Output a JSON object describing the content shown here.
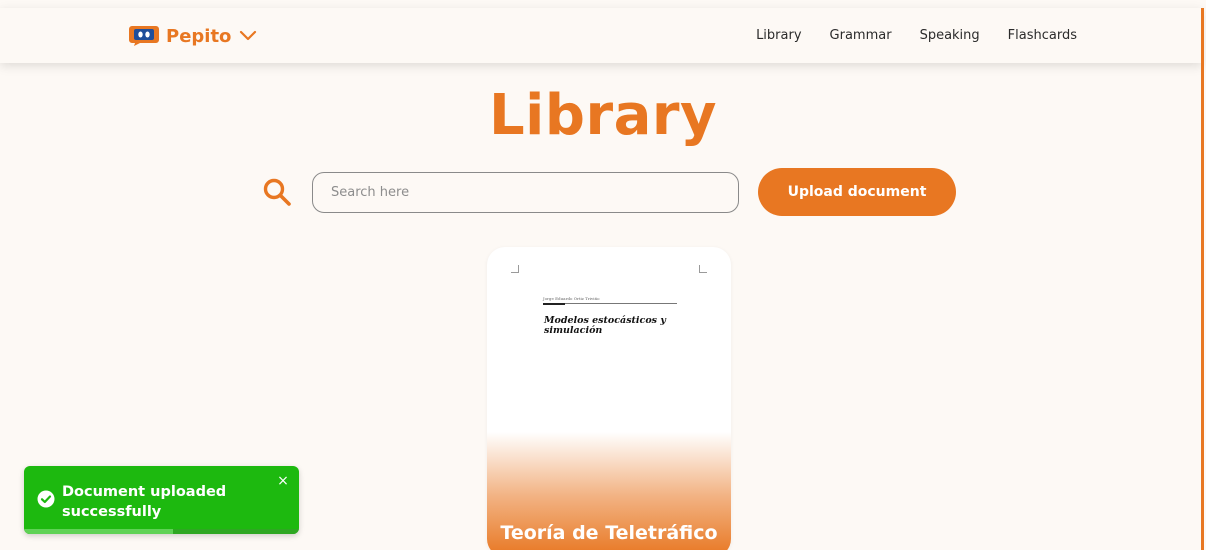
{
  "brand": {
    "name": "Pepito",
    "logo_icon": "pepito-logo-icon",
    "menu_icon": "chevron-down-icon"
  },
  "nav": {
    "items": [
      {
        "label": "Library"
      },
      {
        "label": "Grammar"
      },
      {
        "label": "Speaking"
      },
      {
        "label": "Flashcards"
      }
    ]
  },
  "main": {
    "title": "Library",
    "search": {
      "icon": "search-icon",
      "placeholder": "Search here",
      "value": ""
    },
    "upload_button": "Upload document"
  },
  "documents": [
    {
      "title": "Teoría de Teletráfico",
      "preview": {
        "author": "Jorge Eduardo Ortiz Triviño",
        "heading": "Modelos estocásticos y simulación"
      }
    }
  ],
  "toast": {
    "message": "Document uploaded successfully",
    "icon": "check-circle-icon",
    "close": "×",
    "progress": 0.54
  },
  "colors": {
    "accent": "#e87722",
    "background": "#fdf9f5",
    "success": "#1db90f"
  }
}
